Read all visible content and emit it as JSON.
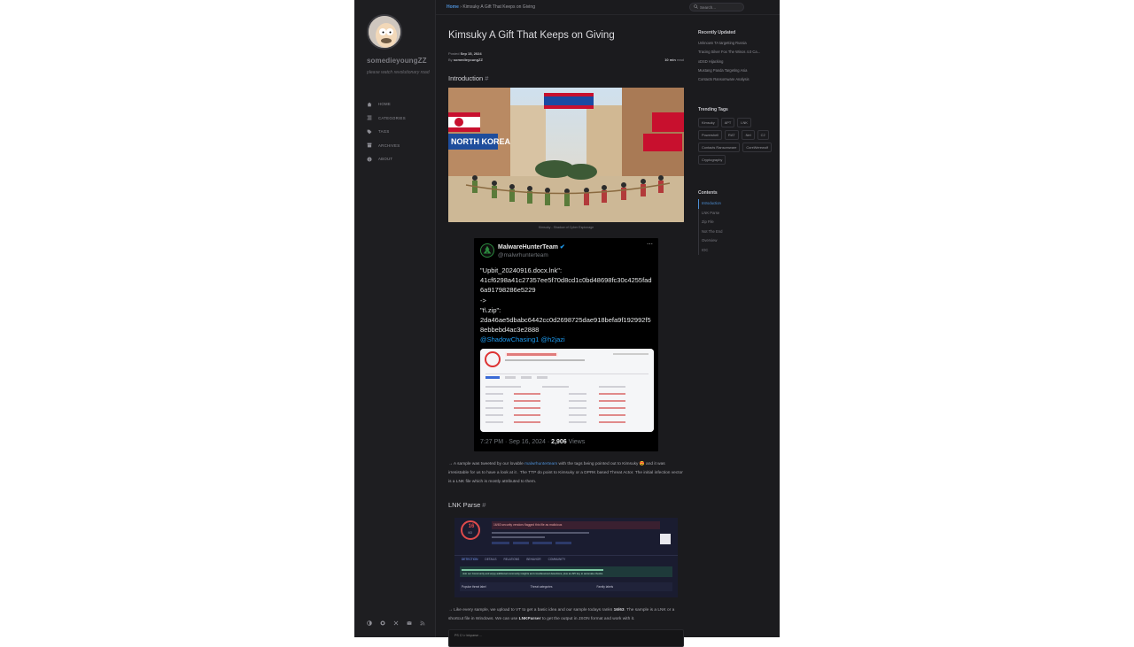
{
  "site": {
    "title": "somedieyoungZZ",
    "subtitle": "please watch revolutionary road"
  },
  "nav": [
    {
      "label": "HOME",
      "icon": "home-icon"
    },
    {
      "label": "CATEGORIES",
      "icon": "stream-icon"
    },
    {
      "label": "TAGS",
      "icon": "tag-icon"
    },
    {
      "label": "ARCHIVES",
      "icon": "archive-icon"
    },
    {
      "label": "ABOUT",
      "icon": "info-icon"
    }
  ],
  "sidebar_footer_icons": [
    "theme-toggle-icon",
    "github-icon",
    "twitter-x-icon",
    "email-icon",
    "rss-icon"
  ],
  "breadcrumb": {
    "home": "Home",
    "current": "Kimsuky A Gift That Keeps on Giving"
  },
  "search": {
    "placeholder": "Search..."
  },
  "post": {
    "title": "Kimsuky A Gift That Keeps on Giving",
    "posted_label": "Posted",
    "posted_date": "Sep 15, 2024",
    "by_label": "By",
    "author": "somedieyoungZZ",
    "read_time": "10 min",
    "read_label": "read"
  },
  "sections": {
    "intro_heading": "Introduction",
    "lnk_heading": "LNK Parse",
    "hash": "#"
  },
  "image_caption": "Kimsuky - Shadow of Cyber Espionage",
  "tweet": {
    "name": "MalwareHunterTeam",
    "handle": "@malwrhunterteam",
    "line1": "\"Upbit_20240916.docx.lnk\":",
    "line2": "41cf6298a41c27357ee5f70d8cd1c0bd48698fc30c4255fad6a91798286e5229",
    "line3": "->",
    "line4": "\"t\\.zip\":",
    "line5": "2da46ae5dbabc6442cc0d2698725dae918befa9f192992f58ebbebd4ac3e2888",
    "mentions": "@ShadowChasing1 @h2jazi",
    "time": "7:27 PM · Sep 16, 2024 ·",
    "views_count": "2,906",
    "views_label": "Views"
  },
  "para1": {
    "pre": "→ A sample was tweeted by our lovable",
    "link": "malwrhunterteam",
    "post": "with the tags being pointed out to Kimsuky 😍 and it was irresistable for us to have a look at it . The TTP do point to Kimsuky or a DPRK based Threat Actor. The initial infection vector is a LNK file which is mostly attributed to them."
  },
  "para2": {
    "pre": "→ Like every sample, we upload to VT to get a basic idea and our sample todays ranks",
    "rank": "16/63",
    "mid": ". The sample is a LNK or a shortcut file in Windows. We can use",
    "tool": "LNKParser",
    "post": "to get the output in JSON format and work with it."
  },
  "vt": {
    "score": "16",
    "total": "/63",
    "banner": "16/63 security vendors flagged this file as malicious",
    "tabs": [
      "DETECTION",
      "DETAILS",
      "RELATIONS",
      "BEHAVIOR",
      "COMMUNITY"
    ],
    "community_note": "Join our Community and enjoy additional community insights and crowdsourced detections, plus an API key to automate checks.",
    "row_labels": [
      "Popular threat label",
      "Threat categories",
      "Family labels"
    ]
  },
  "code_hint": "PS C:\\> lnkparse ...",
  "right": {
    "recent_title": "Recently Updated",
    "recent": [
      "Unknown TA targetting Russia",
      "Tracing Silver Fox The Winos 4.0 Ca...",
      "xDSD Hijacking",
      "Mustang Panda Targeting Asia",
      "Contacts Ransomware Analysis"
    ],
    "tags_title": "Trending Tags",
    "tags": [
      "Kimsuky",
      "APT",
      "LNK",
      "Powershell",
      "RAT",
      ".Net",
      "C2",
      "Contacts Ransomware",
      "CoreWerewolf",
      "Cryptography"
    ],
    "toc_title": "Contents",
    "toc": [
      "Introduction",
      "LNK Parse",
      "Zip File",
      "Not The End",
      "Overview",
      "IOC"
    ]
  }
}
